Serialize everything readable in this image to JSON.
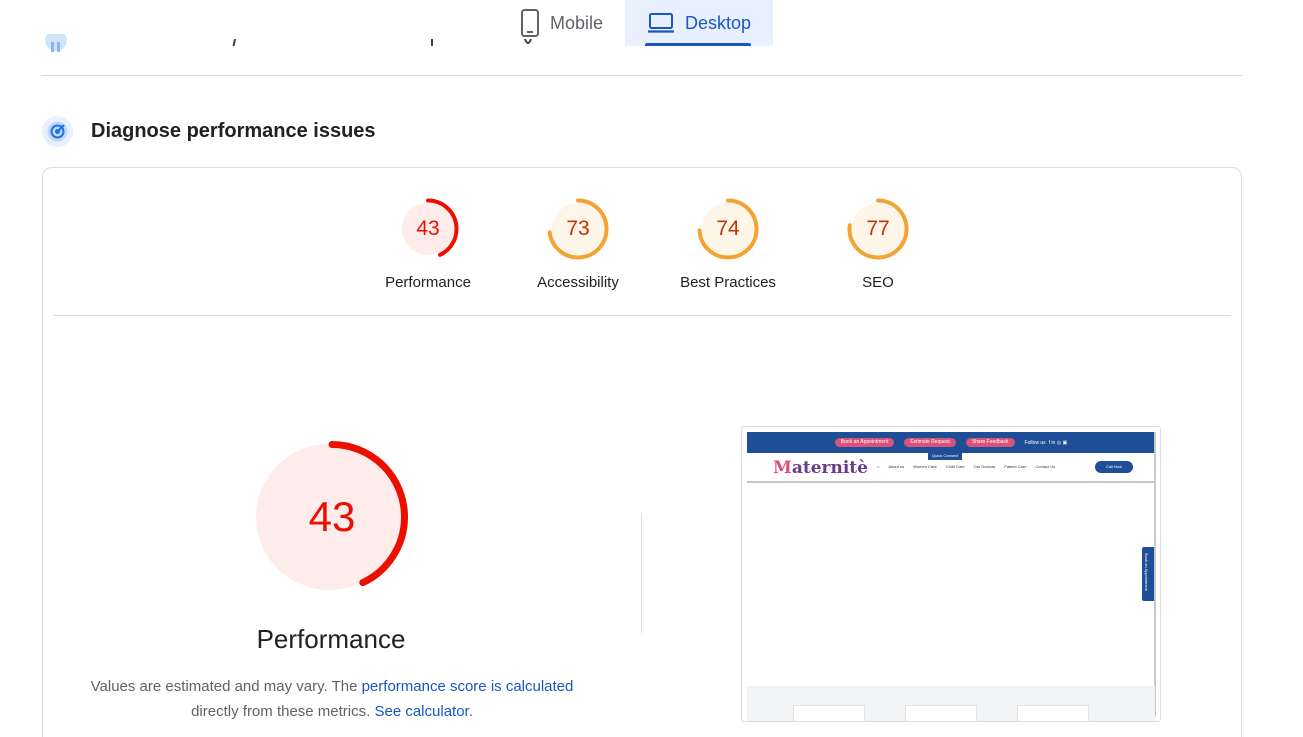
{
  "device_tabs": [
    {
      "label": "Mobile",
      "icon": "smartphone-icon",
      "active": false
    },
    {
      "label": "Desktop",
      "icon": "laptop-icon",
      "active": true
    }
  ],
  "section": {
    "title": "Diagnose performance issues",
    "icon": "diagnose-icon"
  },
  "colors": {
    "fail": "#eb0f00",
    "fail_bg": "#fdecea",
    "average": "#f4a333",
    "average_text": "#c33300",
    "average_bg": "#fef7e9",
    "link": "#1a56c4"
  },
  "gauges": [
    {
      "score": 43,
      "label": "Performance",
      "rating": "fail"
    },
    {
      "score": 73,
      "label": "Accessibility",
      "rating": "average"
    },
    {
      "score": 74,
      "label": "Best Practices",
      "rating": "average"
    },
    {
      "score": 77,
      "label": "SEO",
      "rating": "average"
    }
  ],
  "main_gauge": {
    "score": 43,
    "title": "Performance",
    "rating": "fail"
  },
  "description": {
    "text_1": "Values are estimated and may vary. The ",
    "link_1": "performance score is calculated",
    "text_2": " directly from these metrics. ",
    "link_2": "See calculator",
    "text_3": "."
  },
  "screenshot": {
    "pills": [
      "Book an Appointment",
      "Estimate Request",
      "Share Feedback"
    ],
    "follow_label": "Follow us",
    "quick_connect": "Quick Connect",
    "logo_initial": "M",
    "logo_rest": "aternitè",
    "nav_links": [
      "About us",
      "Women Care",
      "Child Care",
      "Our Doctors",
      "Patient Care",
      "Contact Us"
    ],
    "call_label": "Call Now",
    "side_tab": "Book an Appointment"
  }
}
